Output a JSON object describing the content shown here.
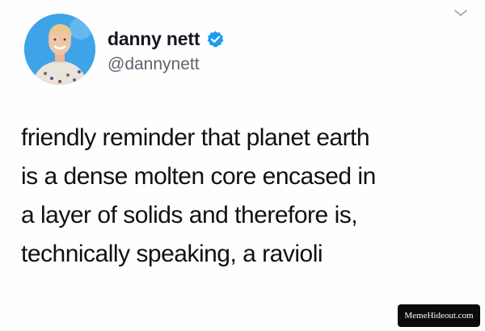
{
  "author": {
    "display_name": "danny nett",
    "handle": "@dannynett",
    "verified": true,
    "avatar_background": "#3fa3e8"
  },
  "tweet": {
    "lines": [
      "friendly reminder that planet earth",
      "is a dense molten core encased in",
      "a layer of solids and therefore is,",
      "technically speaking, a ravioli"
    ]
  },
  "icons": {
    "menu": "chevron-down-icon",
    "verified": "verified-badge-icon"
  },
  "watermark": {
    "text": "MemeHideout.com"
  },
  "colors": {
    "verified_blue": "#1d9bf0",
    "text": "#111111",
    "handle": "#5b6570"
  }
}
